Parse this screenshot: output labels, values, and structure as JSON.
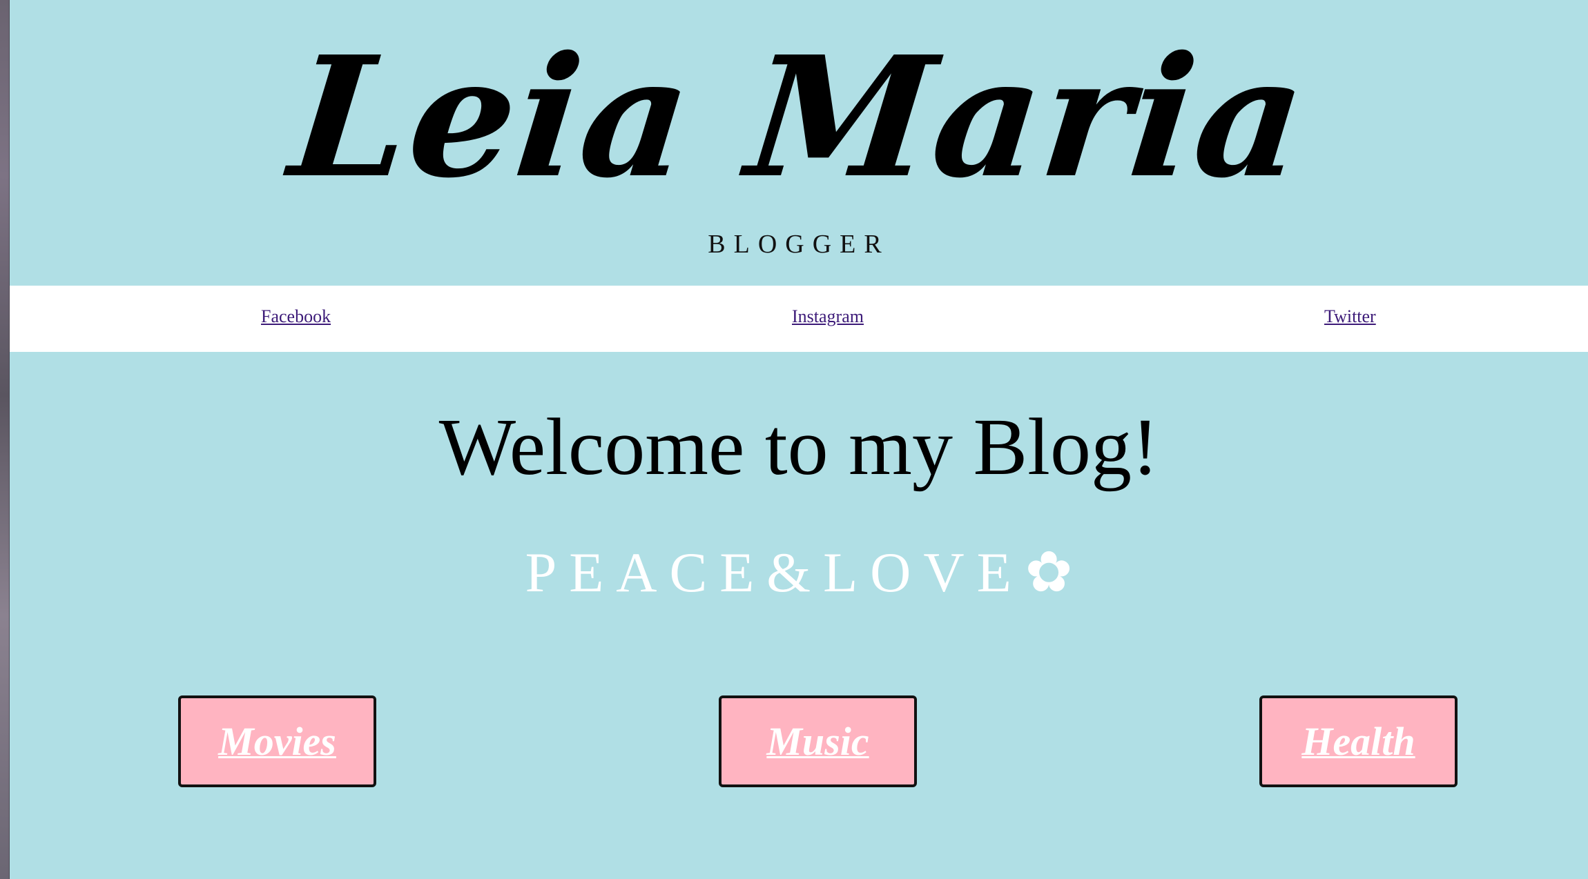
{
  "header": {
    "logo_text": "Leia Maria",
    "subtitle": "BLOGGER"
  },
  "nav": {
    "links": [
      {
        "label": "Facebook"
      },
      {
        "label": "Instagram"
      },
      {
        "label": "Twitter"
      }
    ]
  },
  "main": {
    "welcome": "Welcome to my Blog!",
    "tagline": "PEACE&LOVE",
    "tagline_icon": "✿",
    "categories": [
      {
        "label": "Movies"
      },
      {
        "label": "Music"
      },
      {
        "label": "Health"
      }
    ]
  },
  "colors": {
    "background": "#b0dfe5",
    "nav_background": "#ffffff",
    "button_fill": "#ffb4c1",
    "button_border": "#111111",
    "link": "#3c1a78"
  }
}
